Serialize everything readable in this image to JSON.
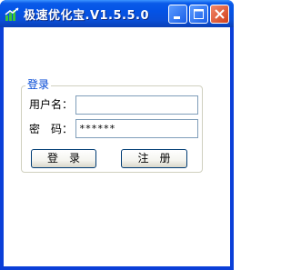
{
  "window": {
    "title": "极速优化宝.V1.5.5.0"
  },
  "login": {
    "group_title": "登录",
    "username_label": "用户名：",
    "username_value": "",
    "password_label": "密　码：",
    "password_value": "******",
    "login_button": "登　录",
    "register_button": "注　册"
  },
  "colors": {
    "titlebar": "#0453e6",
    "group_title": "#0046d5",
    "close_button": "#d2401c"
  },
  "icons": [
    "app-chart-icon",
    "minimize-icon",
    "maximize-icon",
    "close-icon"
  ]
}
